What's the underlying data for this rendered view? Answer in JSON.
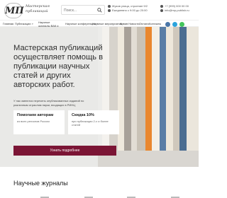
{
  "header": {
    "logo_mark": "МП",
    "logo_text_line1": "Мастерская",
    "logo_text_line2": "публикаций",
    "search_placeholder": "Поиск...",
    "address_line1": "Жуков улица, строение 9/2",
    "address_line2": "Ежедневно с 9:00 до 20:00",
    "phone": "+7 (999) 000 00 00",
    "email": "info@mp-publish.ru"
  },
  "nav": {
    "items": [
      {
        "label": "Главная",
        "has_caret": false
      },
      {
        "label": "Публикации",
        "has_caret": true
      },
      {
        "label": "Научные журналы ВАК и 2023",
        "has_caret": true
      },
      {
        "label": "Научные конференции",
        "has_caret": true
      },
      {
        "label": "Научные мероприятия",
        "has_caret": true
      },
      {
        "label": "Архив",
        "has_caret": false
      },
      {
        "label": "Новости",
        "has_caret": false
      },
      {
        "label": "Оплата",
        "has_caret": false
      },
      {
        "label": "Контакты",
        "has_caret": false
      }
    ],
    "social": [
      {
        "icon": "vk-icon",
        "color": "#4a76a8"
      },
      {
        "icon": "telegram-icon",
        "color": "#2aa3dc"
      },
      {
        "icon": "whatsapp-icon",
        "color": "#43c55b"
      }
    ]
  },
  "hero": {
    "title": "Мастерская публикаций осуществляет помощь в публикации научных статей и других авторских работ.",
    "note": "У нас имеются перечень опубликованных изданий по различным отраслям науки, входящих в РИНЦ",
    "features": [
      {
        "title": "Помогаем авторам",
        "text": "из всех регионов России"
      },
      {
        "title": "Скидка 10%",
        "text": "при публикации 2-х и более статей"
      }
    ],
    "cta_label": "Узнать подробнее"
  },
  "section": {
    "title": "Научные журналы"
  },
  "colors": {
    "accent": "#7b1535",
    "hero_bg": "#e9e9e7"
  }
}
